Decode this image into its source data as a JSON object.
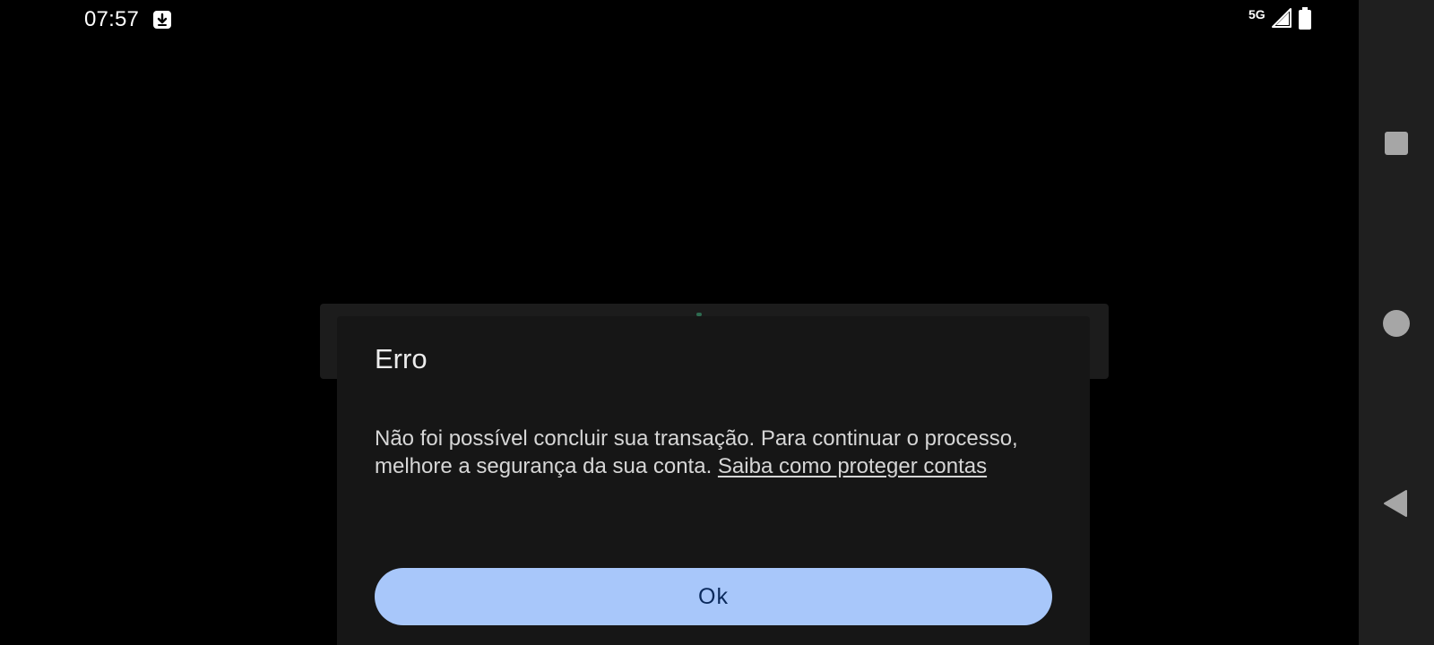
{
  "status_bar": {
    "time": "07:57",
    "network": "5G",
    "icons": [
      "download-icon",
      "signal-icon",
      "battery-icon"
    ]
  },
  "dialog": {
    "title": "Erro",
    "message": "Não foi possível concluir sua transação. Para continuar o processo, melhore a segurança da sua conta. ",
    "link_text": "Saiba como proteger contas",
    "ok_label": "Ok"
  },
  "navigation_bar": {
    "buttons": [
      "recents-icon",
      "home-icon",
      "back-icon"
    ]
  },
  "colors": {
    "background": "#000000",
    "dialog_background": "#161616",
    "primary_button": "#a8c7fa",
    "primary_button_text": "#0b2a5c",
    "nav_bar": "#1f1f1f",
    "nav_icon": "#a6a6a6"
  }
}
